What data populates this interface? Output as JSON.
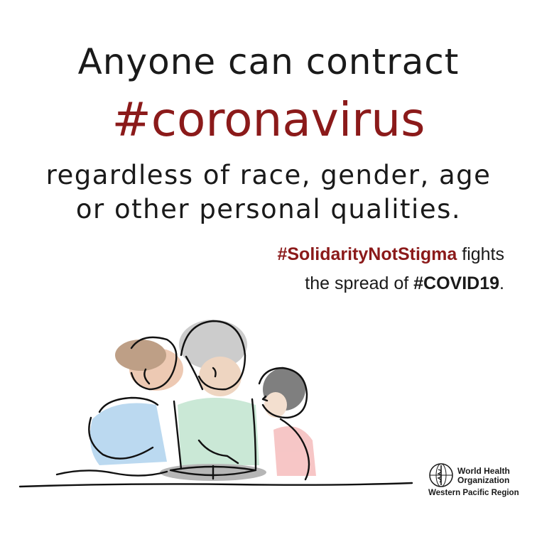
{
  "headline": {
    "line1": "Anyone can contract",
    "line2": "#coronavirus",
    "line3": "regardless of race, gender, age",
    "line4": "or other personal qualities."
  },
  "tagline": {
    "hashtag1": "#SolidarityNotStigma",
    "line1_rest": " fights",
    "line2_prefix": "the spread of ",
    "hashtag2": "#COVID19",
    "line2_suffix": "."
  },
  "logo": {
    "name_line1": "World Health",
    "name_line2": "Organization",
    "region": "Western Pacific Region"
  },
  "colors": {
    "accent": "#8b1a1a",
    "text": "#1a1a1a",
    "background": "#ffffff"
  }
}
